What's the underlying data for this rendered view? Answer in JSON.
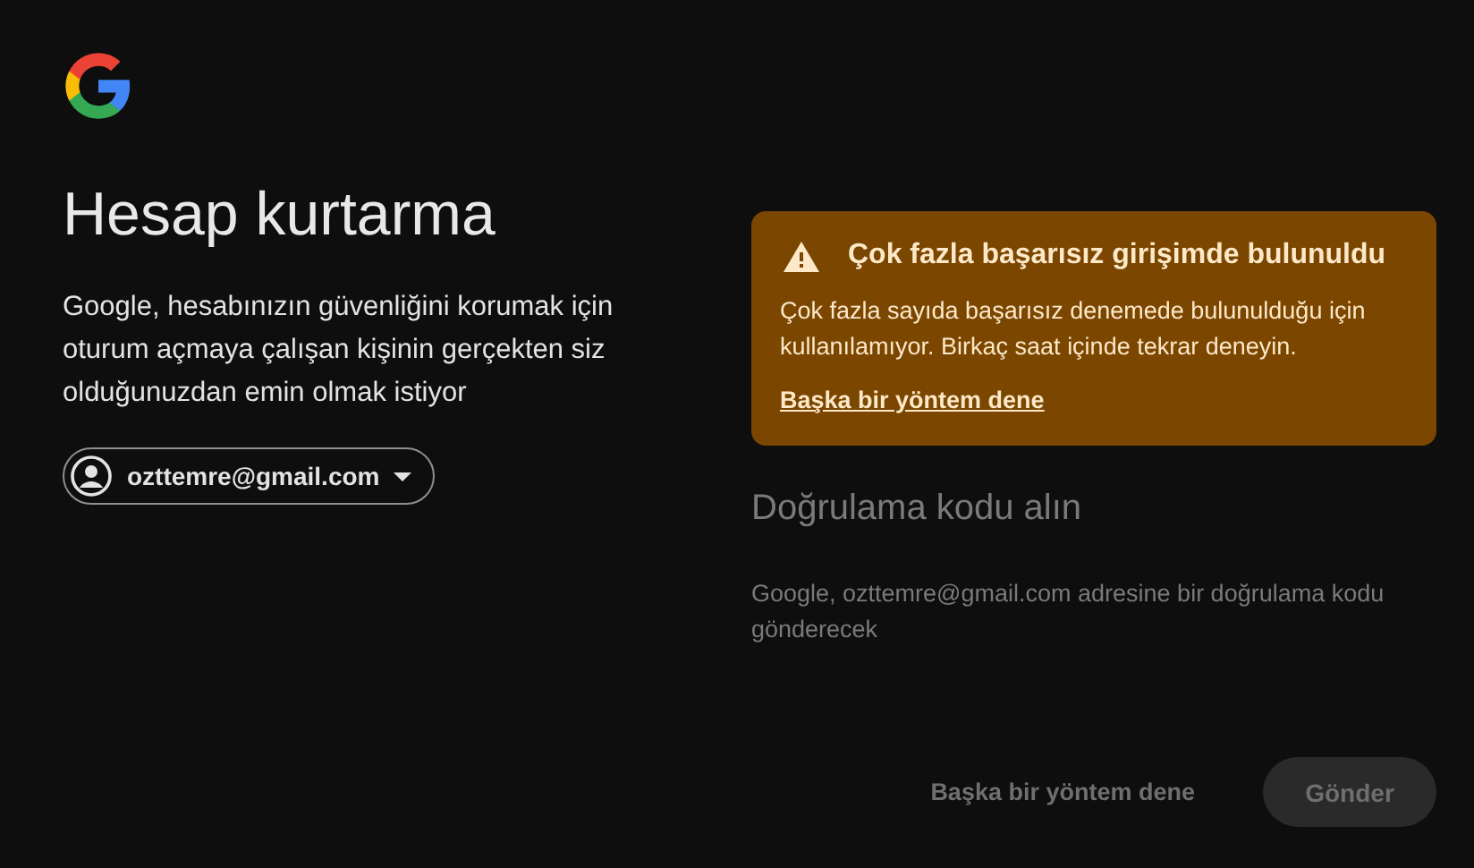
{
  "title": "Hesap kurtarma",
  "description": "Google, hesabınızın güvenliğini korumak için oturum açmaya çalışan kişinin gerçekten siz olduğunuzdan emin olmak istiyor",
  "account_chip": {
    "email": "ozttemre@gmail.com"
  },
  "alert": {
    "title": "Çok fazla başarısız girişimde bulunuldu",
    "message": "Çok fazla sayıda başarısız denemede bulunulduğu için kullanılamıyor. Birkaç saat içinde tekrar deneyin.",
    "link": "Başka bir yöntem dene"
  },
  "section": {
    "title": "Doğrulama kodu alın",
    "text": "Google, ozttemre@gmail.com adresine bir doğrulama kodu gönderecek",
    "disabled": true
  },
  "buttons": [
    {
      "kind": "text",
      "label": "Başka bir yöntem dene",
      "disabled": true
    },
    {
      "kind": "filled",
      "label": "Gönder",
      "disabled": true
    }
  ]
}
